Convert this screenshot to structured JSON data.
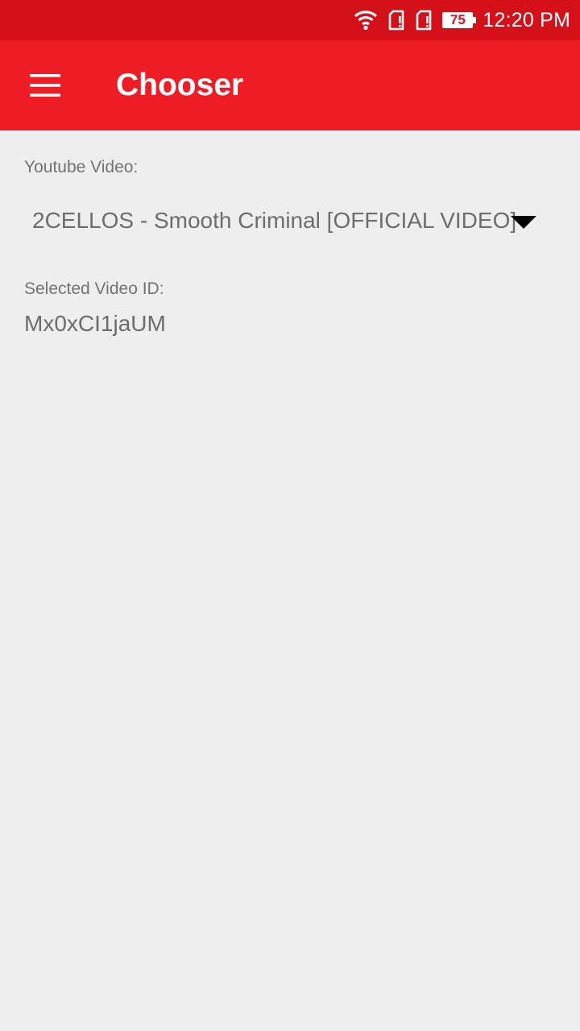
{
  "status_bar": {
    "battery_level": "75",
    "time": "12:20 PM",
    "icons": [
      "wifi-icon",
      "sim-card-icon",
      "sim-card-icon",
      "battery-icon"
    ]
  },
  "app_bar": {
    "menu_icon": "hamburger-menu-icon",
    "title": "Chooser"
  },
  "main": {
    "youtube_label": "Youtube Video:",
    "selected_video_title": "2CELLOS - Smooth Criminal [OFFICIAL VIDEO]",
    "dropdown_icon": "dropdown-arrow-icon",
    "selected_id_label": "Selected Video ID:",
    "selected_id_value": "Mx0xCI1jaUM"
  },
  "colors": {
    "status_bar": "#d41118",
    "app_bar": "#ee1c25",
    "background": "#eeeeee",
    "secondary_text": "#737373"
  }
}
